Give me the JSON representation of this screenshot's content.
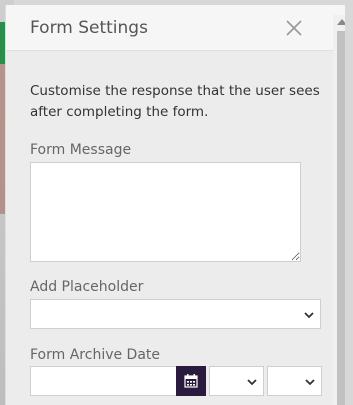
{
  "panel": {
    "title": "Form Settings",
    "description": "Customise the response that the user sees after completing the form.",
    "form_message_label": "Form Message",
    "form_message_value": "",
    "add_placeholder_label": "Add Placeholder",
    "add_placeholder_value": "",
    "archive_date_label": "Form Archive Date",
    "archive_date_value": "",
    "archive_hour_value": "",
    "archive_minute_value": ""
  },
  "icons": {
    "close": "close-icon",
    "calendar": "calendar-icon",
    "dropdown": "chevron-down-icon"
  },
  "colors": {
    "calendar_button": "#2a1a3d",
    "panel_bg": "#ececec",
    "header_bg": "#f6f6f6"
  }
}
